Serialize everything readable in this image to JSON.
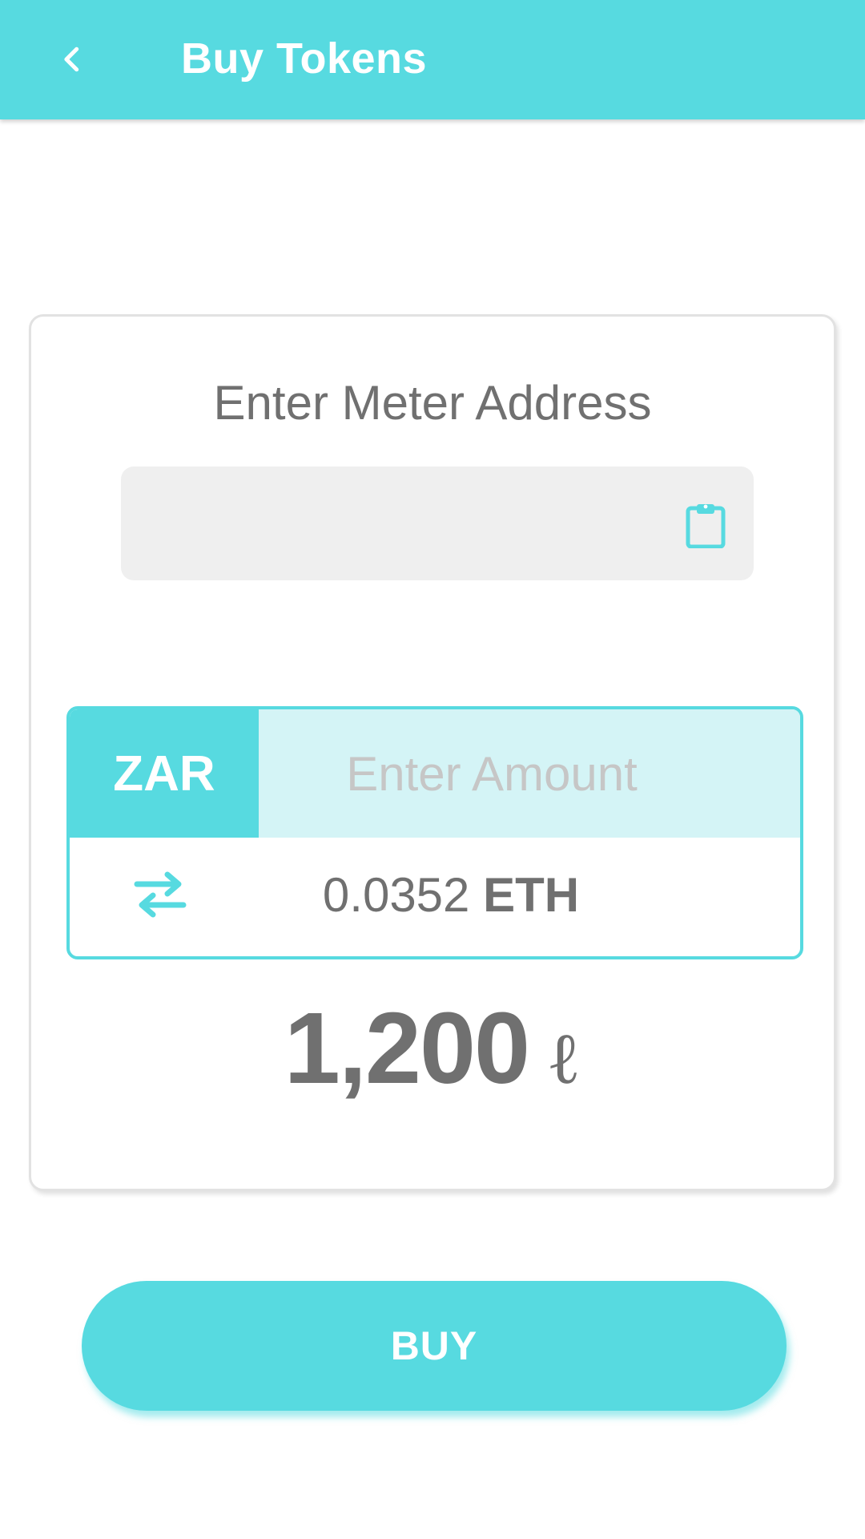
{
  "header": {
    "title": "Buy Tokens",
    "back_icon": "chevron-left-icon"
  },
  "meter": {
    "label": "Enter Meter Address",
    "value": "",
    "paste_icon": "clipboard-icon"
  },
  "amount": {
    "currency": "ZAR",
    "placeholder": "Enter Amount",
    "value": "",
    "swap_icon": "swap-arrows-icon",
    "converted_value": "0.0352",
    "converted_unit": "ETH"
  },
  "tokens": {
    "total": "1,200",
    "unit_symbol": "ℓ"
  },
  "actions": {
    "buy_label": "BUY"
  },
  "colors": {
    "accent": "#57dae0",
    "accent_light": "#d4f4f6",
    "text_gray": "#707070",
    "field_bg": "#efefef"
  }
}
